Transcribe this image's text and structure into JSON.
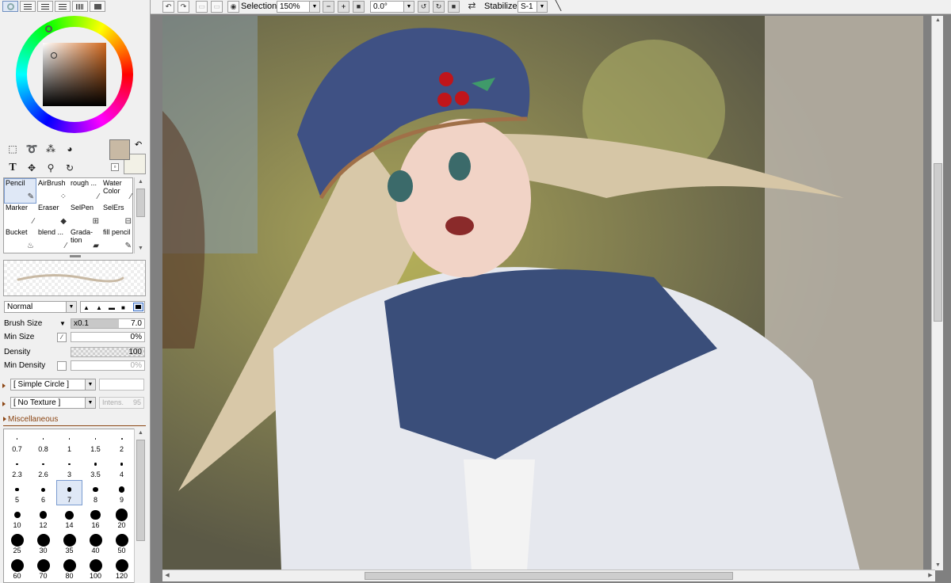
{
  "view_tabs": [
    "color-circle",
    "rgb-sliders",
    "hsv-sliders",
    "palette",
    "swatch",
    "scratchpad"
  ],
  "colors": {
    "primary": "#c8b9a4",
    "secondary": "#f2f1e6",
    "selection": "#dfe8f6"
  },
  "tools": [
    "rect-select",
    "lasso",
    "magic-wand",
    "fill-shape",
    "text",
    "move",
    "zoom",
    "rotate",
    "hand",
    "eyedropper"
  ],
  "brushes": [
    {
      "label": "Pencil",
      "icon": "pencil"
    },
    {
      "label": "AirBrush",
      "icon": "airbrush"
    },
    {
      "label": "rough ...",
      "icon": "brush"
    },
    {
      "label": "Water\nColor",
      "icon": "brush"
    },
    {
      "label": "Marker",
      "icon": "marker"
    },
    {
      "label": "Eraser",
      "icon": "eraser"
    },
    {
      "label": "SelPen",
      "icon": "selpen"
    },
    {
      "label": "SelErs",
      "icon": "selers"
    },
    {
      "label": "Bucket",
      "icon": "bucket"
    },
    {
      "label": "blend ...",
      "icon": "brush"
    },
    {
      "label": "Grada-\ntion",
      "icon": "gradient"
    },
    {
      "label": "fill pencil",
      "icon": "pencil"
    }
  ],
  "blend_mode": "Normal",
  "brush_size": {
    "label": "Brush Size",
    "multiplier": "x0.1",
    "value": "7.0"
  },
  "min_size": {
    "label": "Min Size",
    "value": "0%"
  },
  "density": {
    "label": "Density",
    "value": "100"
  },
  "min_density": {
    "label": "Min Density",
    "value": "0%"
  },
  "shape": "[ Simple Circle ]",
  "texture": "[ No Texture ]",
  "texture_intensity": {
    "label": "Intens.",
    "value": "95"
  },
  "misc_label": "Miscellaneous",
  "sizes": [
    "0.7",
    "0.8",
    "1",
    "1.5",
    "2",
    "2.3",
    "2.6",
    "3",
    "3.5",
    "4",
    "5",
    "6",
    "7",
    "8",
    "9",
    "10",
    "12",
    "14",
    "16",
    "20",
    "25",
    "30",
    "35",
    "40",
    "50",
    "60",
    "70",
    "80",
    "100",
    "120"
  ],
  "selected_size": "7",
  "toolbar": {
    "selection_label": "Selection",
    "zoom": "150%",
    "rotation": "0.0°",
    "stabilizer_label": "Stabilizer",
    "stabilizer_value": "S-1"
  }
}
